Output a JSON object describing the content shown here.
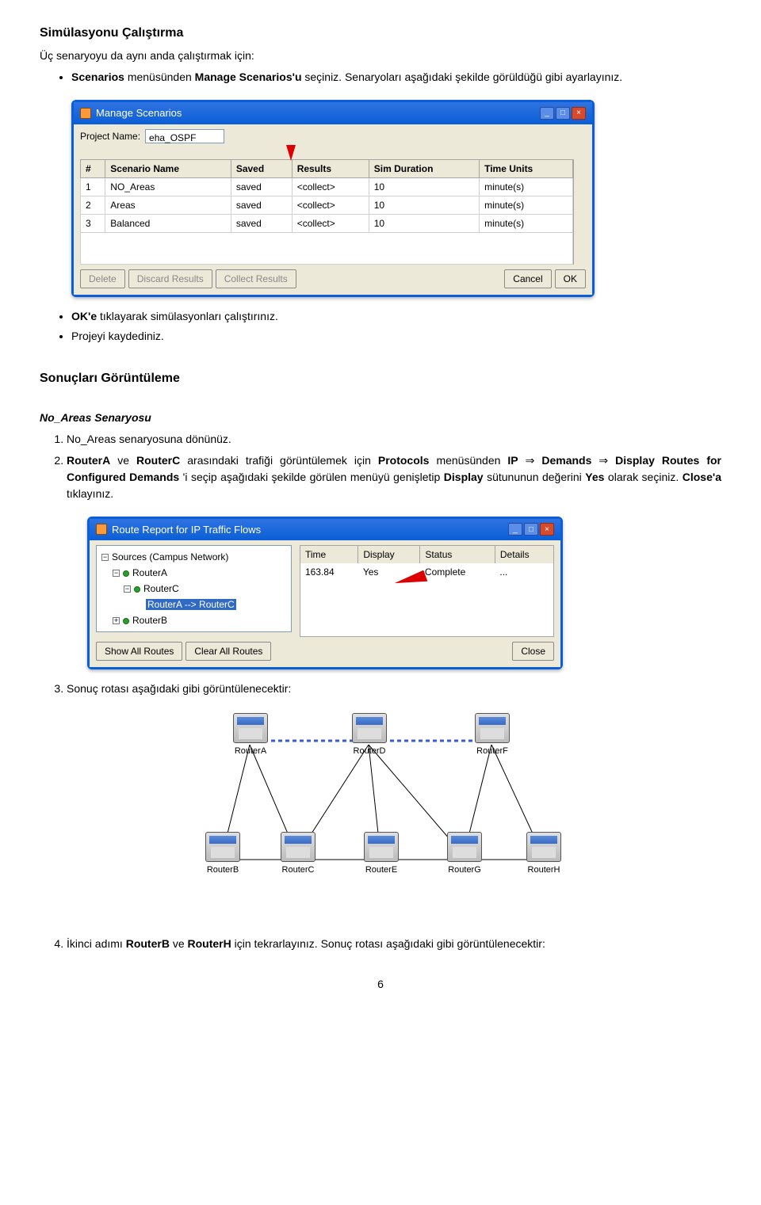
{
  "heading1": "Simülasyonu Çalıştırma",
  "intro1": "Üç senaryoyu da aynı anda çalıştırmak için:",
  "bullet1a_pre": "Scenarios",
  "bullet1a_mid": " menüsünden ",
  "bullet1a_b2": "Manage Scenarios'u",
  "bullet1a_post": " seçiniz. Senaryoları aşağıdaki şekilde görüldüğü gibi ayarlayınız.",
  "win1": {
    "title": "Manage Scenarios",
    "proj_label": "Project Name:",
    "proj_value": "eha_OSPF",
    "cols": [
      "#",
      "Scenario Name",
      "Saved",
      "Results",
      "Sim Duration",
      "Time Units"
    ],
    "rows": [
      [
        "1",
        "NO_Areas",
        "saved",
        "<collect>",
        "10",
        "minute(s)"
      ],
      [
        "2",
        "Areas",
        "saved",
        "<collect>",
        "10",
        "minute(s)"
      ],
      [
        "3",
        "Balanced",
        "saved",
        "<collect>",
        "10",
        "minute(s)"
      ]
    ],
    "btns": {
      "delete": "Delete",
      "discard": "Discard Results",
      "collect": "Collect Results",
      "cancel": "Cancel",
      "ok": "OK"
    }
  },
  "bullet2a_pre": "OK'e",
  "bullet2a_post": " tıklayarak simülasyonları çalıştırınız.",
  "bullet2b": "Projeyi kaydediniz.",
  "heading2": "Sonuçları Görüntüleme",
  "heading3": "No_Areas Senaryosu",
  "step1": "No_Areas senaryosuna dönünüz.",
  "step2_a": "RouterA",
  "step2_b": " ve ",
  "step2_c": "RouterC",
  "step2_d": " arasındaki trafiği görüntülemek için ",
  "step2_e": "Protocols",
  "step2_f": " menüsünden ",
  "step2_g": "IP",
  "step2_h": " ⇒ ",
  "step2_i": "Demands",
  "step2_j": " ⇒ ",
  "step2_k": "Display Routes for Configured Demands",
  "step2_l": " 'i seçip aşağıdaki şekilde görülen menüyü genişletip ",
  "step2_m": "Display",
  "step2_n": " sütununun değerini ",
  "step2_o": "Yes",
  "step2_p": " olarak seçiniz. ",
  "step2_q": "Close'a",
  "step2_r": " tıklayınız.",
  "win2": {
    "title": "Route Report for IP Traffic Flows",
    "tree_root": "Sources (Campus Network)",
    "t_ra": "RouterA",
    "t_rc": "RouterC",
    "t_leaf": "RouterA --> RouterC",
    "t_rb": "RouterB",
    "cols": [
      "Time",
      "Display",
      "Status",
      "Details"
    ],
    "row": [
      "163.84",
      "Yes",
      "Complete",
      "..."
    ],
    "btns": {
      "show": "Show All Routes",
      "clear": "Clear All Routes",
      "close": "Close"
    }
  },
  "step3": "Sonuç rotası aşağıdaki gibi görüntülenecektir:",
  "nodes": {
    "ra": "RouterA",
    "rd": "RouterD",
    "rf": "RouterF",
    "rb": "RouterB",
    "rc": "RouterC",
    "re": "RouterE",
    "rg": "RouterG",
    "rh": "RouterH"
  },
  "step4_a": "İkinci adımı ",
  "step4_b": "RouterB",
  "step4_c": " ve ",
  "step4_d": "RouterH",
  "step4_e": " için tekrarlayınız. Sonuç rotası aşağıdaki gibi görüntülenecektir:",
  "pagenum": "6"
}
